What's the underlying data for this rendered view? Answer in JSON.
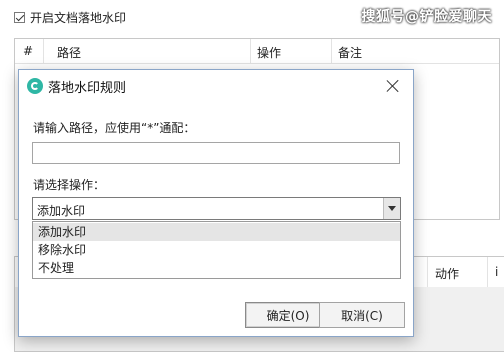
{
  "background": {
    "enable_checkbox_label": "开启文档落地水印",
    "table1_headers": [
      "#",
      "路径",
      "操作",
      "备注"
    ],
    "table2_headers": [
      "动作",
      "i"
    ]
  },
  "watermark_text": "搜狐号@铲脸爱聊天",
  "dialog": {
    "title": "落地水印规则",
    "path_label": "请输入路径，应使用“*”通配：",
    "path_value": "",
    "operation_label": "请选择操作：",
    "operation_selected": "添加水印",
    "operation_options": [
      "添加水印",
      "移除水印",
      "不处理"
    ],
    "ok_label": "确定(O)",
    "cancel_label": "取消(C)"
  },
  "colors": {
    "icon_teal": "#2fb7a5",
    "dialog_border": "#8aa5c8",
    "selected_option_bg": "#e5e5e5"
  },
  "icons": {
    "app": "app-logo-icon",
    "close": "close-icon",
    "dropdown": "chevron-down-icon"
  }
}
